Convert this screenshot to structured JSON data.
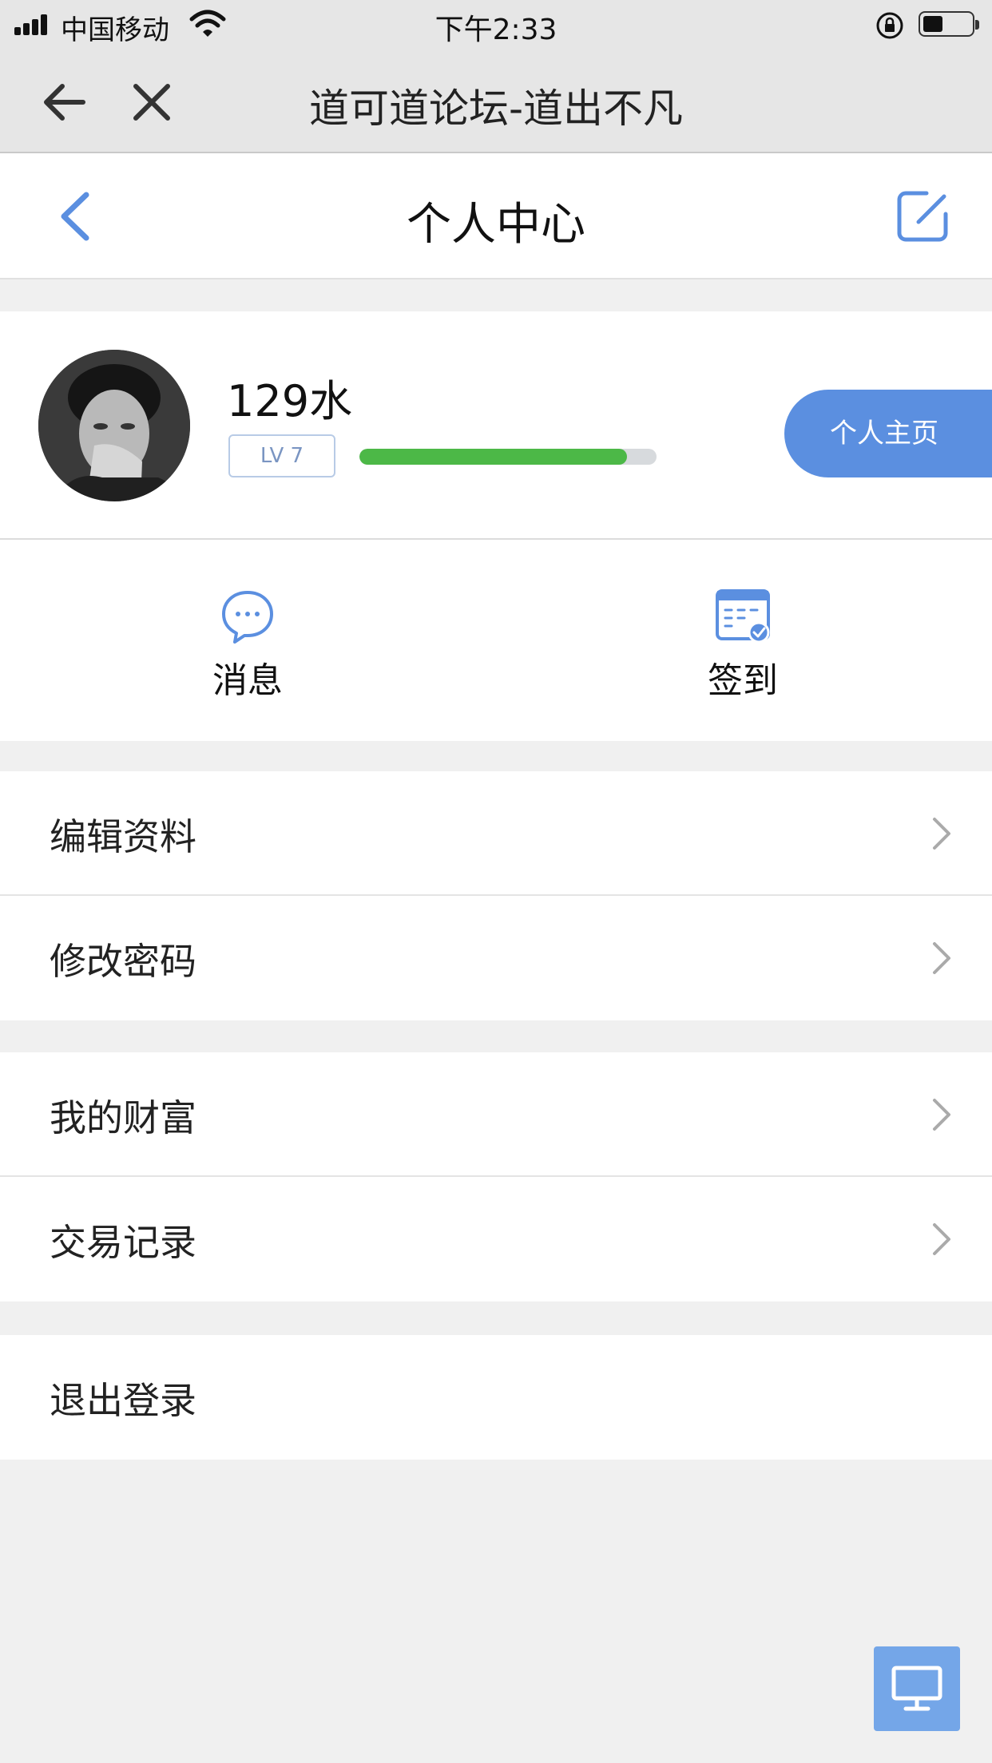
{
  "status_bar": {
    "carrier": "中国移动",
    "time": "下午2:33",
    "battery_level": 0.45
  },
  "browser": {
    "title": "道可道论坛-道出不凡",
    "icons": [
      "arrow-left-icon",
      "close-icon"
    ]
  },
  "header": {
    "title": "个人中心",
    "icons": [
      "chevron-left-icon",
      "edit-icon"
    ]
  },
  "profile": {
    "username": "129水",
    "level": "LV 7",
    "progress": 0.9,
    "homepage_label": "个人主页"
  },
  "quick_actions": [
    {
      "label": "消息",
      "icon": "chat-bubble-icon"
    },
    {
      "label": "签到",
      "icon": "calendar-check-icon"
    }
  ],
  "menu_groups": [
    [
      {
        "label": "编辑资料"
      },
      {
        "label": "修改密码"
      }
    ],
    [
      {
        "label": "我的财富"
      },
      {
        "label": "交易记录"
      }
    ],
    [
      {
        "label": "退出登录"
      }
    ]
  ],
  "colors": {
    "accent": "#5b8fe0",
    "progress": "#4cb847",
    "background": "#f0f0f0"
  },
  "floating_button": {
    "icon": "desktop-icon"
  }
}
